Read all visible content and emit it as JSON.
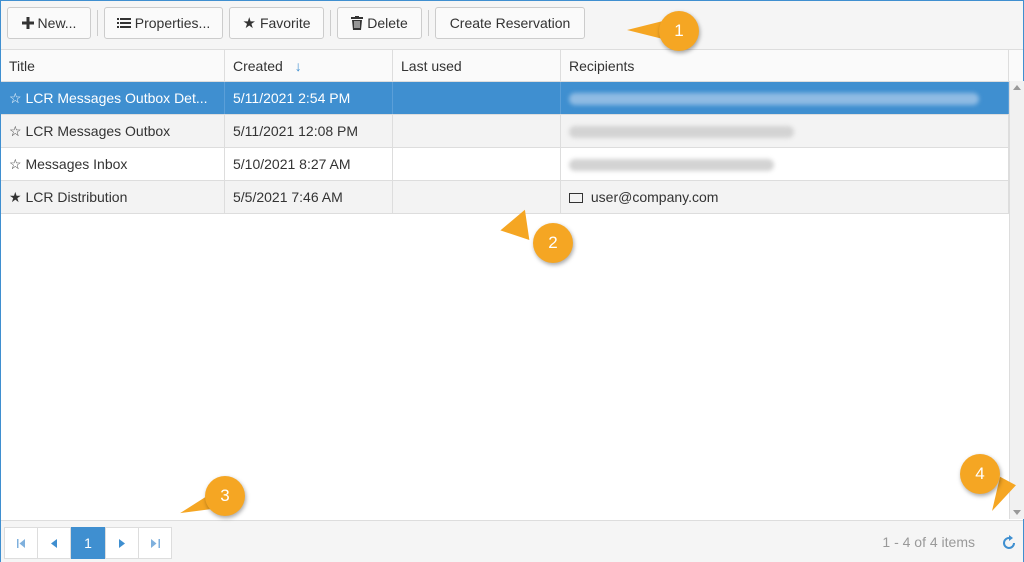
{
  "toolbar": {
    "new_label": "New...",
    "properties_label": "Properties...",
    "favorite_label": "Favorite",
    "delete_label": "Delete",
    "create_reservation_label": "Create Reservation"
  },
  "columns": [
    "Title",
    "Created",
    "Last used",
    "Recipients"
  ],
  "sort": {
    "column": "Created",
    "direction": "descending"
  },
  "rows": [
    {
      "title": "LCR Messages Outbox Det...",
      "created": "5/11/2021 2:54 PM",
      "last_used": "",
      "recipient": "",
      "favorite": false,
      "selected": true
    },
    {
      "title": "LCR Messages Outbox",
      "created": "5/11/2021 12:08 PM",
      "last_used": "",
      "recipient": "",
      "favorite": false,
      "selected": false
    },
    {
      "title": "Messages Inbox",
      "created": "5/10/2021 8:27 AM",
      "last_used": "",
      "recipient": "",
      "favorite": false,
      "selected": false
    },
    {
      "title": "LCR Distribution",
      "created": "5/5/2021 7:46 AM",
      "last_used": "",
      "recipient": "user@company.com",
      "favorite": true,
      "selected": false
    }
  ],
  "pager": {
    "current_page": "1",
    "summary": "1 - 4 of 4 items"
  },
  "callouts": [
    "1",
    "2",
    "3",
    "4"
  ],
  "colors": {
    "accent": "#3f8fd0",
    "callout": "#f5a623"
  }
}
